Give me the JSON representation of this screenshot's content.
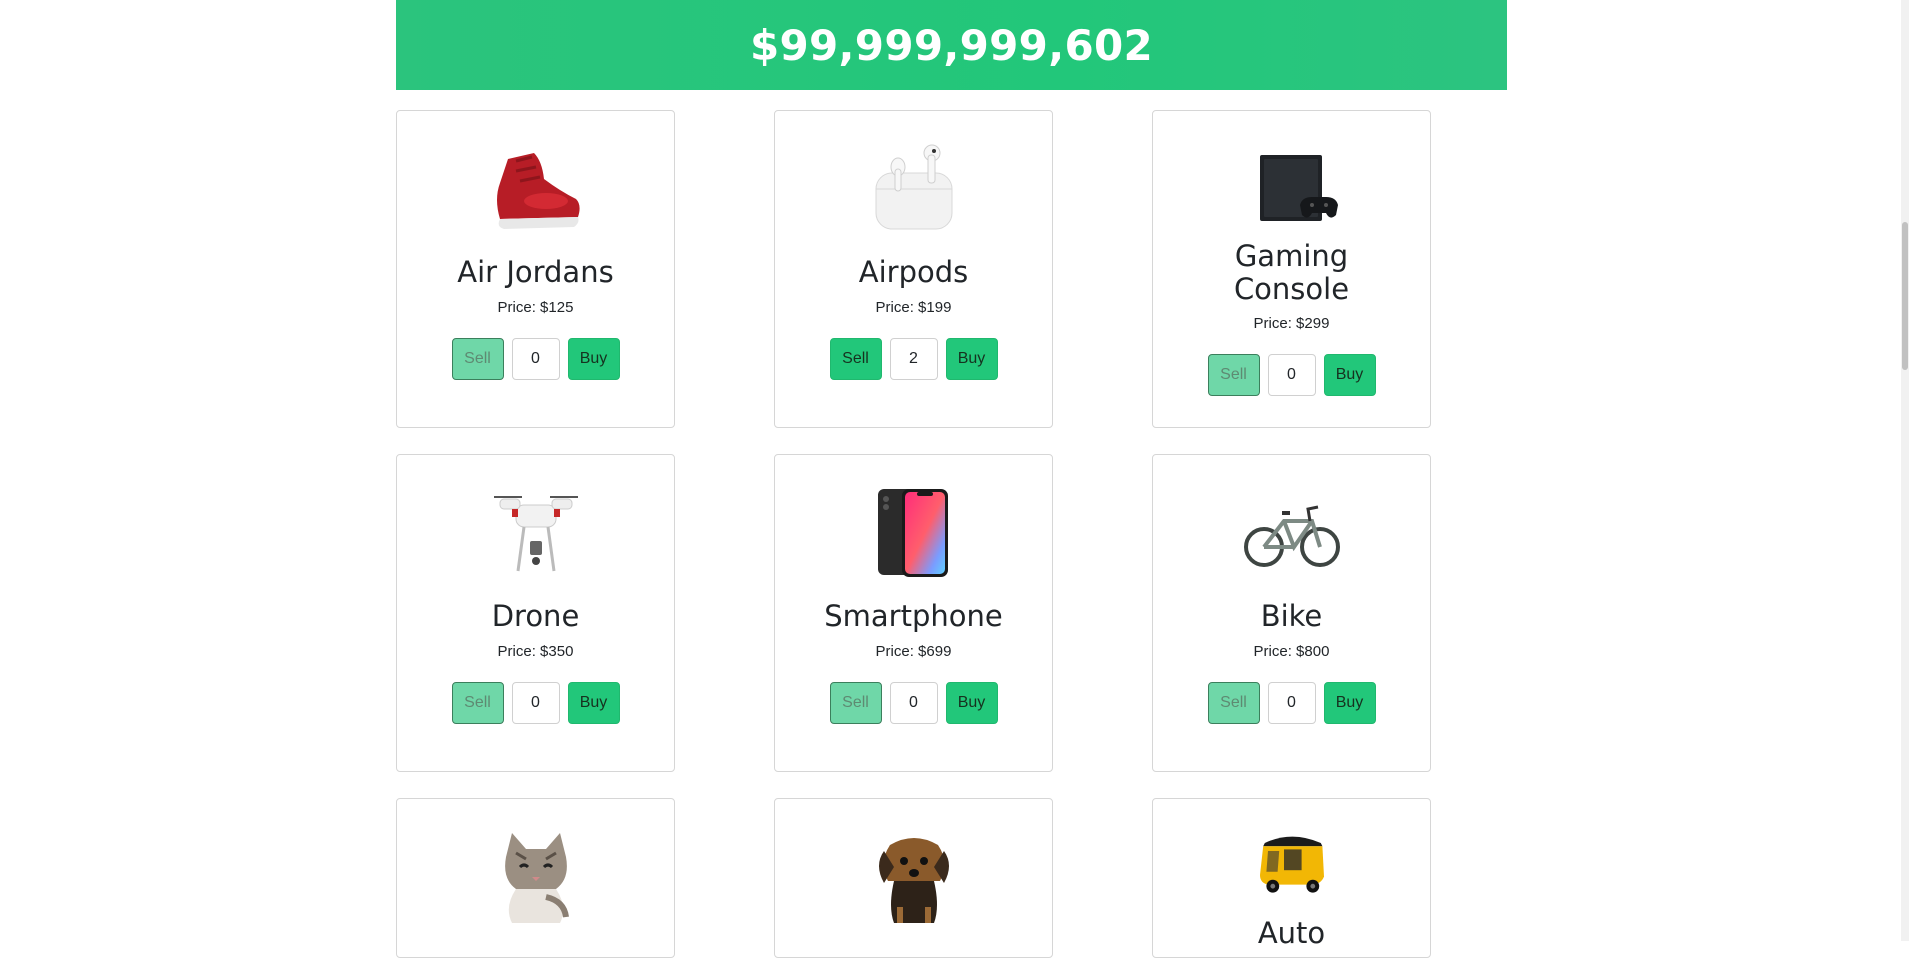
{
  "balance": "$99,999,999,602",
  "products": [
    {
      "name": "Air Jordans",
      "price": "Price: $125",
      "qty": "0",
      "sell": "Sell",
      "buy": "Buy",
      "sell_disabled": true,
      "icon": "sneaker-icon"
    },
    {
      "name": "Airpods",
      "price": "Price: $199",
      "qty": "2",
      "sell": "Sell",
      "buy": "Buy",
      "sell_disabled": false,
      "icon": "earbuds-icon"
    },
    {
      "name": "Gaming Console",
      "price": "Price: $299",
      "qty": "0",
      "sell": "Sell",
      "buy": "Buy",
      "sell_disabled": true,
      "icon": "game-console-icon"
    },
    {
      "name": "Drone",
      "price": "Price: $350",
      "qty": "0",
      "sell": "Sell",
      "buy": "Buy",
      "sell_disabled": true,
      "icon": "drone-icon"
    },
    {
      "name": "Smartphone",
      "price": "Price: $699",
      "qty": "0",
      "sell": "Sell",
      "buy": "Buy",
      "sell_disabled": true,
      "icon": "smartphone-icon"
    },
    {
      "name": "Bike",
      "price": "Price: $800",
      "qty": "0",
      "sell": "Sell",
      "buy": "Buy",
      "sell_disabled": true,
      "icon": "bicycle-icon"
    },
    {
      "name": "",
      "icon": "cat-icon"
    },
    {
      "name": "",
      "icon": "dog-icon"
    },
    {
      "name": "Auto",
      "icon": "auto-rickshaw-icon"
    }
  ],
  "colors": {
    "accent": "#22c77a",
    "accent_disabled": "#6fd7a8"
  }
}
